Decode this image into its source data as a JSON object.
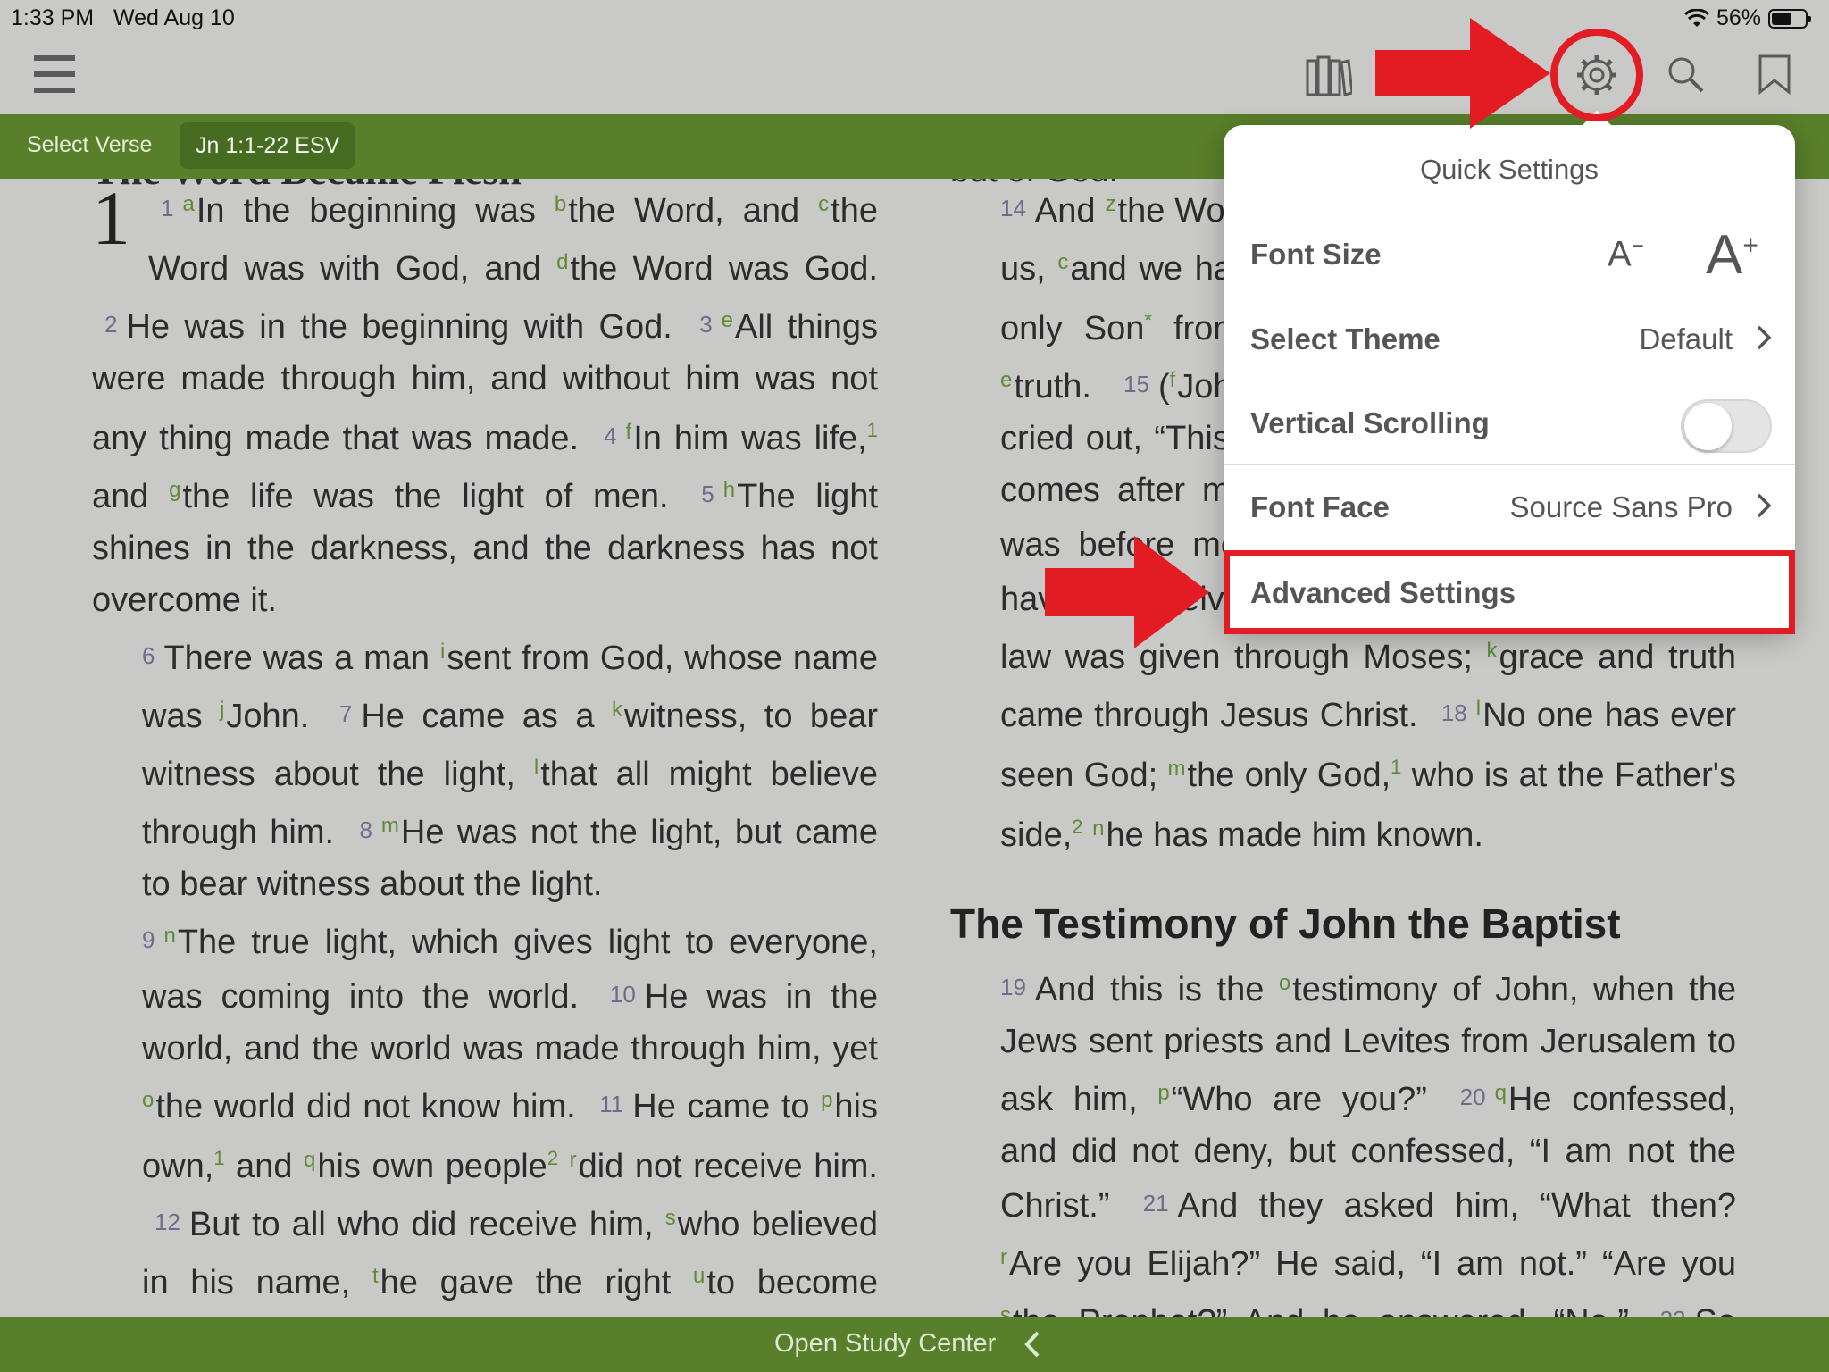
{
  "status_bar": {
    "time": "1:33 PM",
    "date": "Wed Aug 10",
    "battery": "56%",
    "battery_level": 0.56
  },
  "toolbar": {
    "menu_icon": "hamburger-menu-icon",
    "library_icon": "library-books-icon",
    "settings_icon": "gear-icon",
    "search_icon": "search-icon",
    "bookmark_icon": "bookmark-icon"
  },
  "verse_bar": {
    "select_verse": "Select Verse",
    "reference": "Jn 1:1-22 ESV"
  },
  "reader": {
    "left_cutoff_heading": "The Word Became Flesh",
    "chapter": "1",
    "right_cutoff": "but of God.",
    "heading2": "The Testimony of John the Baptist"
  },
  "quick_settings": {
    "title": "Quick Settings",
    "font_size_label": "Font Size",
    "font_smaller": "A",
    "font_larger": "A",
    "select_theme_label": "Select Theme",
    "select_theme_value": "Default",
    "vertical_scrolling_label": "Vertical Scrolling",
    "vertical_scrolling_on": false,
    "font_face_label": "Font Face",
    "font_face_value": "Source Sans Pro",
    "advanced_settings_label": "Advanced Settings"
  },
  "bottom_bar": {
    "label": "Open Study Center"
  },
  "colors": {
    "green_bar": "#587f2a",
    "annotation_red": "#e31c24",
    "background": "#c9c9c7"
  }
}
